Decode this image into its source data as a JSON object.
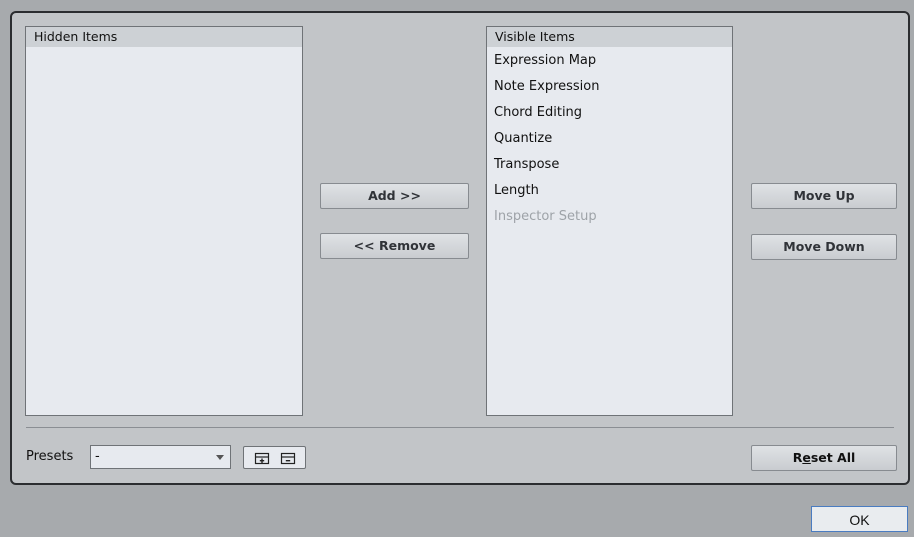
{
  "hidden_list": {
    "header": "Hidden Items",
    "items": []
  },
  "visible_list": {
    "header": "Visible Items",
    "items": [
      {
        "label": "Expression Map",
        "enabled": true
      },
      {
        "label": "Note Expression",
        "enabled": true
      },
      {
        "label": "Chord Editing",
        "enabled": true
      },
      {
        "label": "Quantize",
        "enabled": true
      },
      {
        "label": "Transpose",
        "enabled": true
      },
      {
        "label": "Length",
        "enabled": true
      },
      {
        "label": "Inspector Setup",
        "enabled": false
      }
    ]
  },
  "buttons": {
    "add": "Add >>",
    "remove": "<< Remove",
    "move_up": "Move Up",
    "move_down": "Move Down",
    "reset_all_pre": "R",
    "reset_all_underlined": "e",
    "reset_all_post": "set All",
    "ok": "OK"
  },
  "presets": {
    "label": "Presets",
    "selected": "-"
  },
  "icons": {
    "save_preset": "save-preset-icon",
    "remove_preset": "remove-preset-icon"
  }
}
